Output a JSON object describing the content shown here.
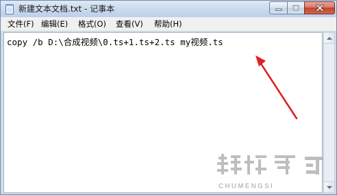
{
  "window": {
    "title": "新建文本文档.txt - 记事本",
    "controls": {
      "minimize_icon": "minimize-icon",
      "maximize_icon": "maximize-icon",
      "close_icon": "close-icon"
    }
  },
  "menubar": {
    "items": [
      {
        "label": "文件(F)"
      },
      {
        "label": "编辑(E)"
      },
      {
        "label": "格式(O)"
      },
      {
        "label": "查看(V)"
      },
      {
        "label": "帮助(H)"
      }
    ]
  },
  "editor": {
    "content": "copy /b D:\\合成视频\\0.ts+1.ts+2.ts my视频.ts"
  },
  "annotation": {
    "type": "red-arrow",
    "color": "#e02020"
  },
  "watermark": {
    "text": "CHUMENGSI",
    "color": "#8a8a8a"
  },
  "colors": {
    "title_bar": "#c9d9ec",
    "close_button": "#c2432c",
    "menu_bg": "#f0f0f0",
    "editor_bg": "#ffffff"
  }
}
